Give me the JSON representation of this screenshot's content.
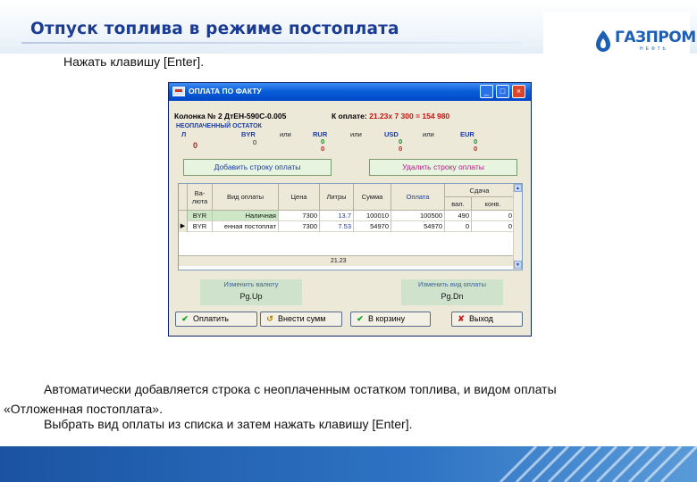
{
  "slide": {
    "title": "Отпуск топлива в режиме постоплата",
    "logo_text": "ГАЗПРОМ",
    "logo_sub": "НЕФТЬ",
    "instruction_top": "Нажать клавишу [Enter].",
    "instruction_bottom_1": "Автоматически добавляется строка с неоплаченным остатком топлива, и видом оплаты",
    "instruction_bottom_2": "«Отложенная постоплата».",
    "instruction_bottom_3": "Выбрать вид оплаты из списка и затем нажать клавишу [Enter]."
  },
  "window": {
    "title": "ОПЛАТА ПО ФАКТУ",
    "minimize": "_",
    "maximize": "□",
    "close": "×",
    "column_info": "Колонка № 2 ДтЕН-590С-0.005",
    "pay_label": "К оплате:",
    "pay_value": "21.23x  7 300 =   154 980",
    "unpaid_label": "НЕОПЛАЧЕННЫЙ ОСТАТОК",
    "unpaid": {
      "liters_label": "Л",
      "liters_value": "0",
      "byr_label": "BYR",
      "byr_value": "0",
      "or1": "или",
      "rur_label": "RUR",
      "rur_v1": "0",
      "rur_v2": "0",
      "or2": "или",
      "usd_label": "USD",
      "usd_v1": "0",
      "usd_v2": "0",
      "or3": "или",
      "eur_label": "EUR",
      "eur_v1": "0",
      "eur_v2": "0"
    },
    "add_row_button": "Добавить строку оплаты",
    "delete_row_button": "Удалить строку оплаты",
    "grid": {
      "headers": {
        "currency_1": "Ва-",
        "currency_2": "люта",
        "pay_type": "Вид оплаты",
        "price": "Цена",
        "liters": "Литры",
        "sum": "Сумма",
        "payment": "Оплата",
        "change": "Сдача",
        "change_cur": "вал.",
        "change_conv": "конв."
      },
      "rows": [
        {
          "currency": "BYR",
          "pay_type": "Наличная",
          "price": "7300",
          "liters": "13.7",
          "sum": "100010",
          "payment": "100500",
          "change_cur": "490",
          "change_conv": "0"
        },
        {
          "currency": "BYR",
          "pay_type": "енная постоплат",
          "price": "7300",
          "liters": "7.53",
          "sum": "54970",
          "payment": "54970",
          "change_cur": "0",
          "change_conv": "0"
        }
      ],
      "total_liters": "21.23"
    },
    "change_currency_caption": "Изменить валюту",
    "change_currency_key": "Pg.Up",
    "change_paytype_caption": "Изменить вид оплаты",
    "change_paytype_key": "Pg.Dn",
    "buttons": {
      "pay": "Оплатить",
      "enter_sum": "Внести сумм",
      "cart": "В корзину",
      "exit": "Выход"
    }
  }
}
